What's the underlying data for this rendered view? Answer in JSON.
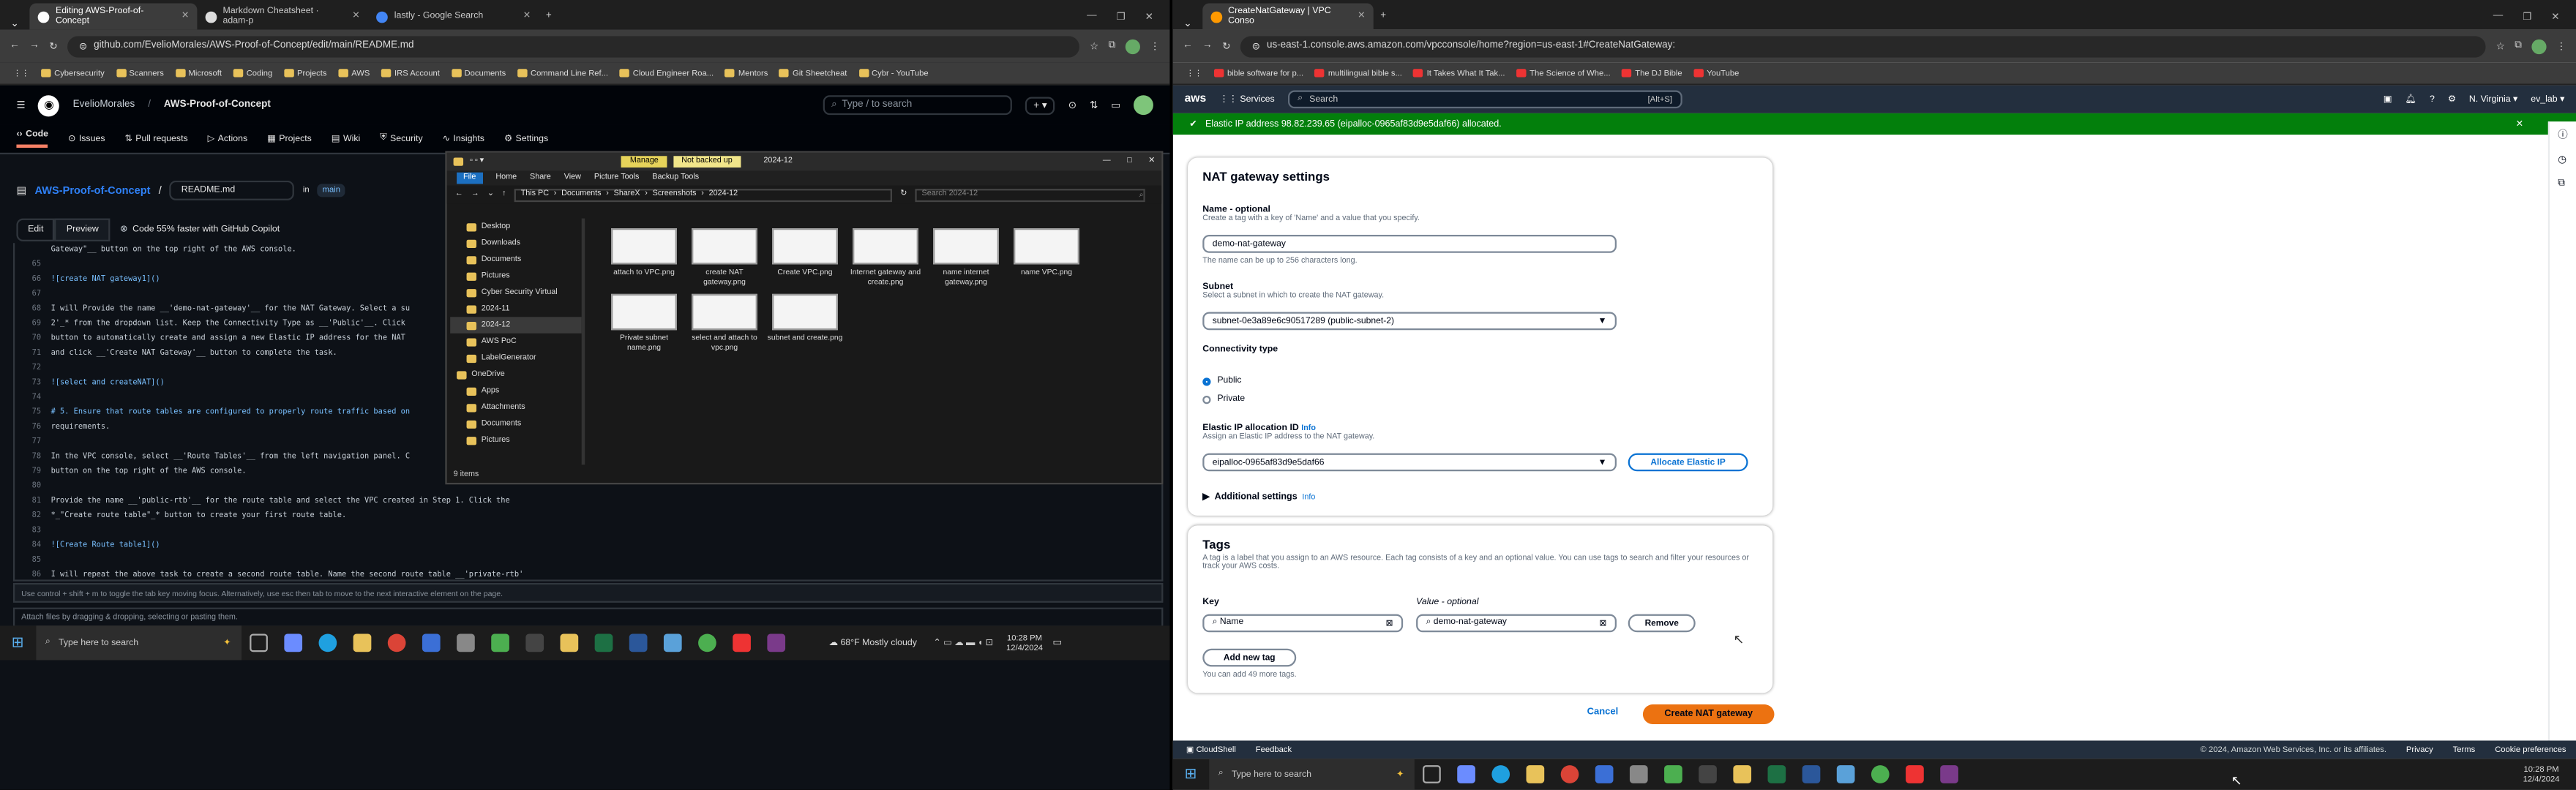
{
  "left": {
    "tabs": [
      {
        "label": "Editing AWS-Proof-of-Concept",
        "active": true
      },
      {
        "label": "Markdown Cheatsheet · adam-p",
        "active": false
      },
      {
        "label": "lastly - Google Search",
        "active": false
      }
    ],
    "url": "github.com/EvelioMorales/AWS-Proof-of-Concept/edit/main/README.md",
    "bookmarks": [
      "Cybersecurity",
      "Scanners",
      "Microsoft",
      "Coding",
      "Projects",
      "AWS",
      "IRS Account",
      "Documents",
      "Command Line Ref...",
      "Cloud Engineer Roa...",
      "Mentors",
      "Git Sheetcheat",
      "Cybr - YouTube"
    ],
    "github": {
      "owner": "EvelioMorales",
      "repo": "AWS-Proof-of-Concept",
      "search_placeholder": "Type / to search",
      "nav": [
        "Code",
        "Issues",
        "Pull requests",
        "Actions",
        "Projects",
        "Wiki",
        "Security",
        "Insights",
        "Settings"
      ],
      "breadcrumb_repo": "AWS-Proof-of-Concept",
      "filename": "README.md",
      "branch_in": "in",
      "branch": "main",
      "edit_tab": "Edit",
      "preview_tab": "Preview",
      "copilot": "Code 55% faster with GitHub Copilot",
      "code_lines": [
        {
          "n": "",
          "t": "Gateway\"__ button on the top right of the AWS console."
        },
        {
          "n": "65",
          "t": ""
        },
        {
          "n": "66",
          "t": "![create NAT gateway1]()",
          "h": true
        },
        {
          "n": "67",
          "t": ""
        },
        {
          "n": "68",
          "t": "I will Provide the name __'demo-nat-gateway'__ for the NAT Gateway. Select a su"
        },
        {
          "n": "69",
          "t": "2'_* from the dropdown list. Keep the Connectivity Type as __'Public'__. Click"
        },
        {
          "n": "70",
          "t": "button to automatically create and assign a new Elastic IP address for the NAT"
        },
        {
          "n": "71",
          "t": "and click __'Create NAT Gateway'__ button to complete the task."
        },
        {
          "n": "72",
          "t": ""
        },
        {
          "n": "73",
          "t": "![select and createNAT]()",
          "h": true
        },
        {
          "n": "74",
          "t": ""
        },
        {
          "n": "75",
          "t": "# 5. Ensure that route tables are configured to properly route traffic based on",
          "h": true
        },
        {
          "n": "76",
          "t": "requirements."
        },
        {
          "n": "77",
          "t": ""
        },
        {
          "n": "78",
          "t": "In the VPC console, select __'Route Tables'__ from the left navigation panel. C"
        },
        {
          "n": "79",
          "t": "button on the top right of the AWS console."
        },
        {
          "n": "80",
          "t": ""
        },
        {
          "n": "81",
          "t": "Provide the name __'public-rtb'__ for the route table and select the VPC created in Step 1. Click the"
        },
        {
          "n": "82",
          "t": "*_\"Create route table\"_* button to create your first route table."
        },
        {
          "n": "83",
          "t": ""
        },
        {
          "n": "84",
          "t": "![Create Route table1]()",
          "h": true
        },
        {
          "n": "85",
          "t": ""
        },
        {
          "n": "86",
          "t": "I will repeat the above task to create a second route table. Name the second route table __'private-rtb'"
        }
      ],
      "tip": "Use control + shift + m to toggle the tab key moving focus. Alternatively, use esc then tab to move to the next interactive element on the page.",
      "attach": "Attach files by dragging & dropping, selecting or pasting them."
    },
    "explorer": {
      "title": "2024-12",
      "manage": "Manage",
      "not_backed": "Not backed up",
      "ribbon": [
        "File",
        "Home",
        "Share",
        "View",
        "Picture Tools",
        "Backup Tools"
      ],
      "path": [
        "This PC",
        "Documents",
        "ShareX",
        "Screenshots",
        "2024-12"
      ],
      "search_placeholder": "Search 2024-12",
      "quick": [
        "Desktop",
        "Downloads",
        "Documents",
        "Pictures",
        "Cyber Security Virtual",
        "2024-11",
        "2024-12",
        "AWS PoC",
        "LabelGenerator",
        "OneDrive",
        "Apps",
        "Attachments",
        "Documents",
        "Pictures"
      ],
      "files": [
        "attach to VPC.png",
        "create NAT gateway.png",
        "Create VPC.png",
        "Internet gateway and create.png",
        "name internet gateway.png",
        "name VPC.png",
        "Private subnet name.png",
        "select and attach to vpc.png",
        "subnet and create.png"
      ],
      "status": "9 items"
    },
    "taskbar": {
      "search": "Type here to search",
      "weather": "68°F  Mostly cloudy",
      "time": "10:28 PM",
      "date": "12/4/2024"
    }
  },
  "right": {
    "tab": "CreateNatGateway | VPC Conso",
    "url": "us-east-1.console.aws.amazon.com/vpcconsole/home?region=us-east-1#CreateNatGateway:",
    "bookmarks": [
      "bible software for p...",
      "multilingual bible s...",
      "It Takes What It Tak...",
      "The Science of Whe...",
      "The DJ Bible",
      "YouTube"
    ],
    "aws": {
      "logo": "aws",
      "services": "Services",
      "search": "Search",
      "shortcut": "[Alt+S]",
      "region": "N. Virginia",
      "account": "ev_lab"
    },
    "banner": "Elastic IP address 98.82.239.65 (eipalloc-0965af83d9e5daf66) allocated.",
    "form": {
      "heading": "NAT gateway settings",
      "name_label": "Name - optional",
      "name_hint": "Create a tag with a key of 'Name' and a value that you specify.",
      "name_value": "demo-nat-gateway",
      "name_hint2": "The name can be up to 256 characters long.",
      "subnet_label": "Subnet",
      "subnet_hint": "Select a subnet in which to create the NAT gateway.",
      "subnet_value": "subnet-0e3a89e6c90517289 (public-subnet-2)",
      "conn_label": "Connectivity type",
      "conn_public": "Public",
      "conn_private": "Private",
      "eip_label": "Elastic IP allocation ID",
      "eip_info": "Info",
      "eip_hint": "Assign an Elastic IP address to the NAT gateway.",
      "eip_value": "eipalloc-0965af83d9e5daf66",
      "eip_button": "Allocate Elastic IP",
      "additional": "Additional settings",
      "additional_info": "Info"
    },
    "tags": {
      "heading": "Tags",
      "hint": "A tag is a label that you assign to an AWS resource. Each tag consists of a key and an optional value. You can use tags to search and filter your resources or track your AWS costs.",
      "key_label": "Key",
      "value_label": "Value - optional",
      "key_value": "Name",
      "value_value": "demo-nat-gateway",
      "remove": "Remove",
      "add": "Add new tag",
      "remaining": "You can add 49 more tags."
    },
    "cancel": "Cancel",
    "create": "Create NAT gateway",
    "footer": {
      "cloudshell": "CloudShell",
      "feedback": "Feedback",
      "copyright": "© 2024, Amazon Web Services, Inc. or its affiliates.",
      "privacy": "Privacy",
      "terms": "Terms",
      "cookies": "Cookie preferences"
    },
    "taskbar": {
      "search": "Type here to search",
      "time": "10:28 PM",
      "date": "12/4/2024"
    }
  }
}
